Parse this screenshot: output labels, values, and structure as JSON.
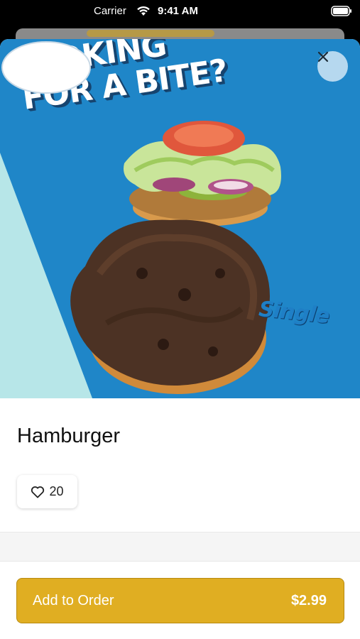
{
  "status_bar": {
    "carrier": "Carrier",
    "time": "9:41 AM"
  },
  "hero": {
    "headline_line1": "LOOKING",
    "headline_line2": "FOR A BITE?",
    "badge": "Single",
    "background_color": "#1f86c8"
  },
  "close_icon": "close-icon",
  "product": {
    "name": "Hamburger",
    "like_count": "20",
    "like_icon": "heart-outline-icon"
  },
  "footer": {
    "add_label": "Add to Order",
    "price": "$2.99",
    "button_color": "#e0ae22"
  }
}
